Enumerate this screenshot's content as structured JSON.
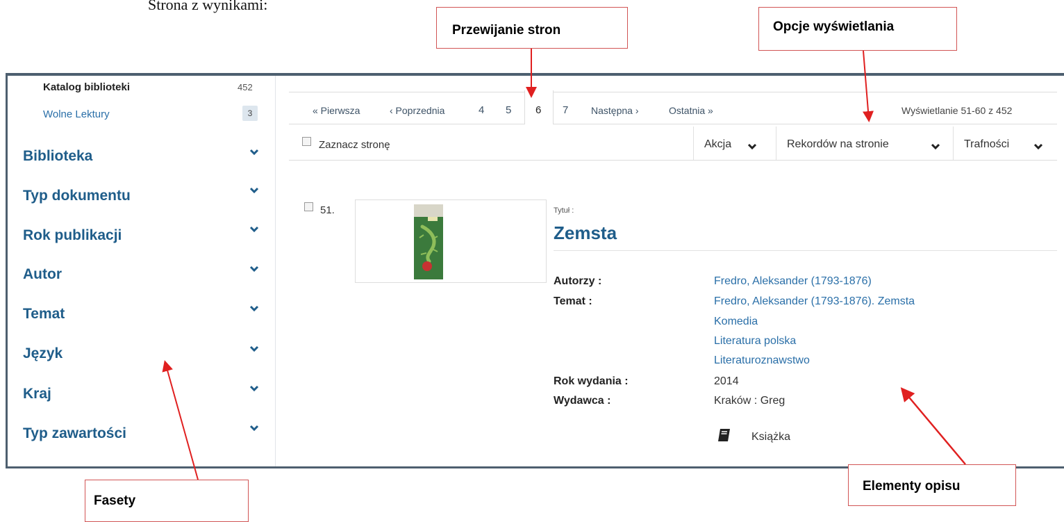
{
  "doc_heading": "Strona z wynikami:",
  "callouts": {
    "paging": "Przewijanie stron",
    "display": "Opcje wyświetlania",
    "facets": "Fasety",
    "description": "Elementy opisu"
  },
  "sidebar": {
    "sources": [
      {
        "label": "Katalog biblioteki",
        "count": "452"
      },
      {
        "label": "Wolne Lektury",
        "count": "3"
      }
    ],
    "facets": [
      "Biblioteka",
      "Typ dokumentu",
      "Rok publikacji",
      "Autor",
      "Temat",
      "Język",
      "Kraj",
      "Typ zawartości"
    ]
  },
  "pager": {
    "first": "« Pierwsza",
    "prev": "‹ Poprzednia",
    "pages": [
      "4",
      "5",
      "6",
      "7"
    ],
    "current": "6",
    "next": "Następna ›",
    "last": "Ostatnia »",
    "showing": "Wyświetlanie 51-60 z 452"
  },
  "toolbar": {
    "select_page": "Zaznacz stronę",
    "action": "Akcja",
    "per_page": "Rekordów na stronie",
    "sort": "Trafności"
  },
  "record": {
    "number": "51.",
    "title_label": "Tytuł :",
    "title": "Zemsta",
    "authors_label": "Autorzy :",
    "authors": "Fredro, Aleksander (1793-1876)",
    "subject_label": "Temat :",
    "subjects": [
      "Fredro, Aleksander (1793-1876). Zemsta",
      "Komedia",
      "Literatura polska",
      "Literaturoznawstwo"
    ],
    "year_label": "Rok wydania :",
    "year": "2014",
    "publisher_label": "Wydawca :",
    "publisher": "Kraków : Greg",
    "format": "Książka",
    "format_icon": "book-icon"
  },
  "colors": {
    "link": "#2a6fa8",
    "facet_title": "#1f5d8a",
    "callout_border": "#d15454",
    "arrow": "#e02020"
  }
}
